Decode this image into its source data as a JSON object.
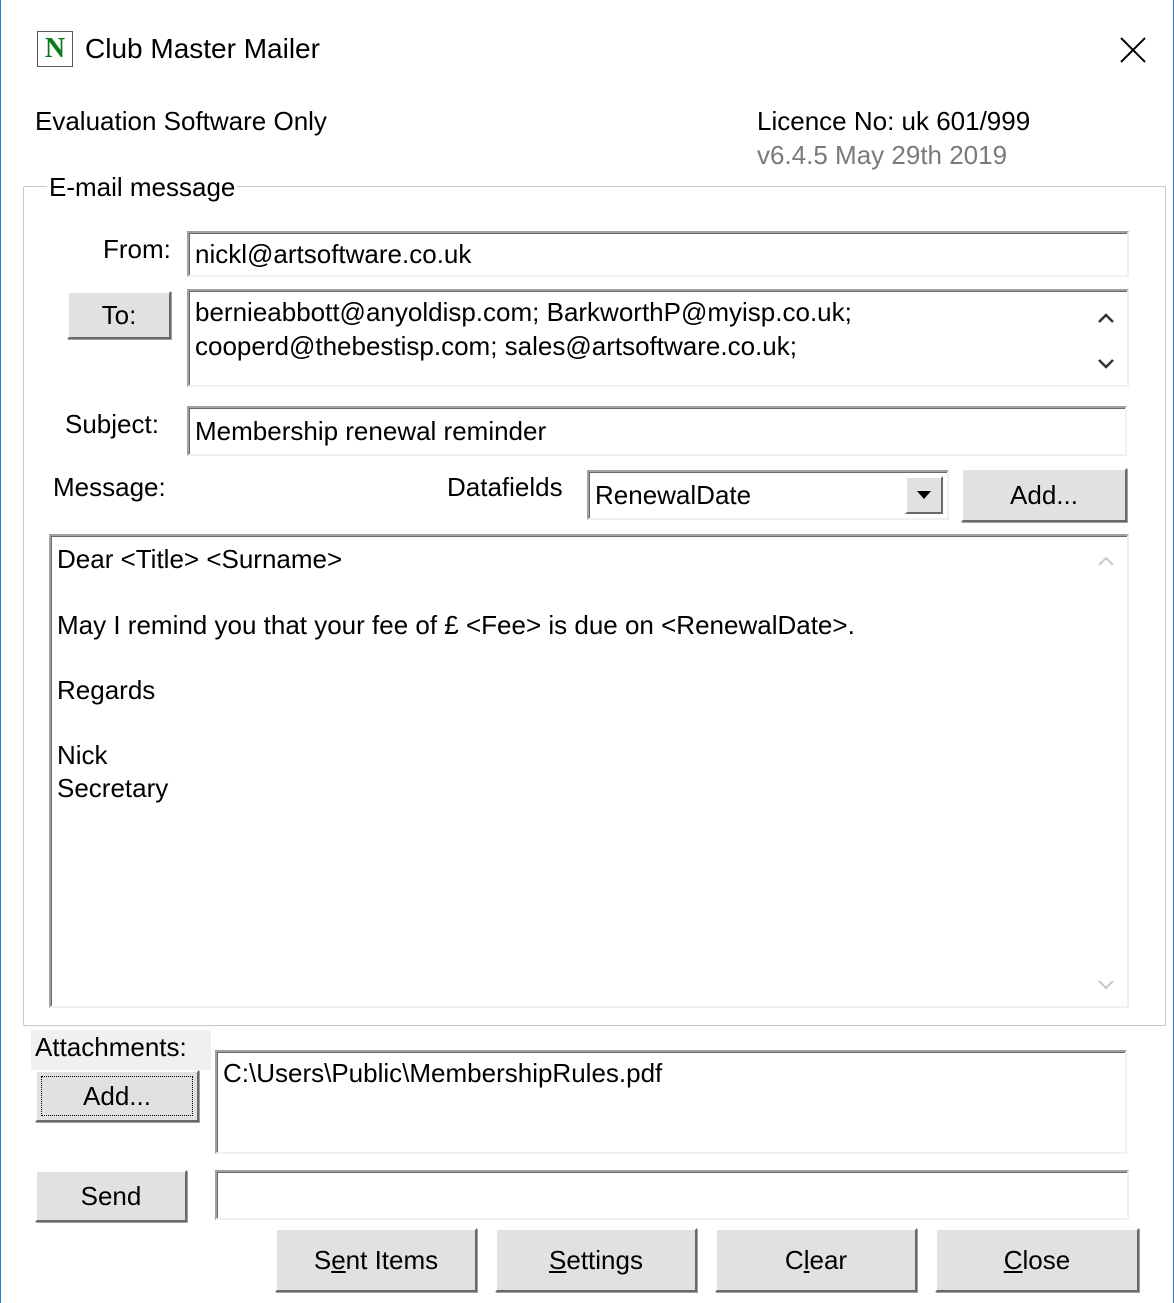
{
  "window": {
    "app_icon_letter": "N",
    "title": "Club Master Mailer"
  },
  "header": {
    "evaluation": "Evaluation Software Only",
    "licence": "Licence No:  uk 601/999",
    "version": "v6.4.5 May 29th 2019"
  },
  "group": {
    "legend": "E-mail message"
  },
  "from": {
    "label": "From:",
    "value": "nickl@artsoftware.co.uk"
  },
  "to": {
    "button": "To:",
    "lines": [
      "bernieabbott@anyoldisp.com; BarkworthP@myisp.co.uk;",
      "cooperd@thebestisp.com; sales@artsoftware.co.uk;"
    ]
  },
  "subject": {
    "label": "Subject:",
    "value": "Membership renewal reminder"
  },
  "message": {
    "label": "Message:",
    "datafields_label": "Datafields",
    "datafields_selected": "RenewalDate",
    "add_button": "Add...",
    "body_lines": [
      "Dear <Title> <Surname>",
      "",
      "May I remind you that your fee of £ <Fee> is due on <RenewalDate>.",
      "",
      "Regards",
      "",
      "Nick",
      "Secretary"
    ]
  },
  "attachments": {
    "label": "Attachments:",
    "add_button": "Add...",
    "files": [
      "C:\\Users\\Public\\MembershipRules.pdf"
    ]
  },
  "send": {
    "button": "Send",
    "status": ""
  },
  "footer": {
    "sent_items": {
      "pre": "S",
      "u": "e",
      "post": "nt Items"
    },
    "settings": {
      "pre": "",
      "u": "S",
      "post": "ettings"
    },
    "clear": {
      "pre": "C",
      "u": "l",
      "post": "ear"
    },
    "close": {
      "pre": "",
      "u": "C",
      "post": "lose"
    }
  },
  "colors": {
    "icon_green": "#0b7a1d",
    "window_border": "#2b7bd1",
    "button_face": "#e1e1e1",
    "version_text": "#7a7a7a"
  },
  "icons": {
    "close": "close-icon",
    "app": "app-icon",
    "dropdown": "chevron-down-icon",
    "scroll_up": "chevron-up-icon",
    "scroll_down": "chevron-down-icon"
  }
}
